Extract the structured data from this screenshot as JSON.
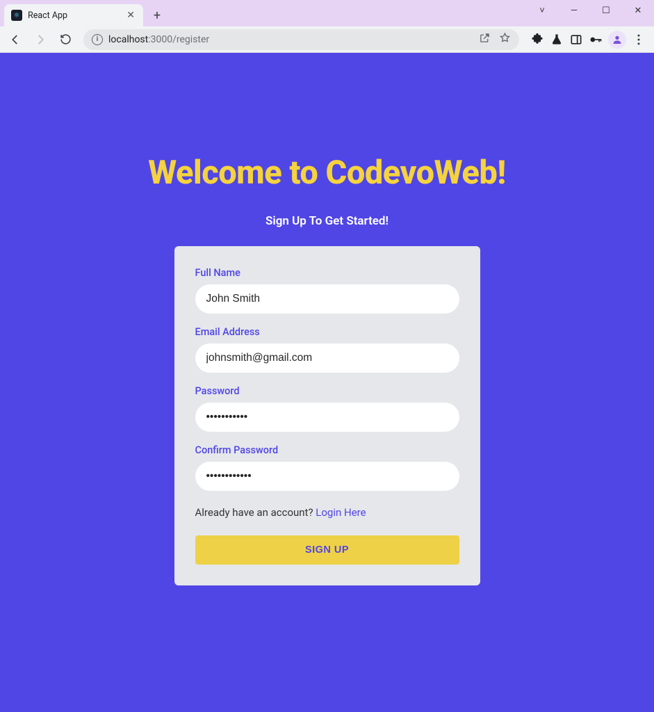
{
  "browser": {
    "tab_title": "React App",
    "url_host": "localhost",
    "url_port_path": ":3000/register"
  },
  "hero": {
    "title": "Welcome to CodevoWeb!",
    "subtitle": "Sign Up To Get Started!"
  },
  "form": {
    "fullname": {
      "label": "Full Name",
      "value": "John Smith"
    },
    "email": {
      "label": "Email Address",
      "value": "johnsmith@gmail.com"
    },
    "password": {
      "label": "Password",
      "value": "•••••••••••"
    },
    "confirm": {
      "label": "Confirm Password",
      "value": "••••••••••••"
    },
    "login_prompt_text": "Already have an account? ",
    "login_link_text": "Login Here",
    "submit_label": "SIGN UP"
  },
  "colors": {
    "page_bg": "#5046e5",
    "accent_yellow": "#f5d33d",
    "card_bg": "#e5e7eb"
  }
}
